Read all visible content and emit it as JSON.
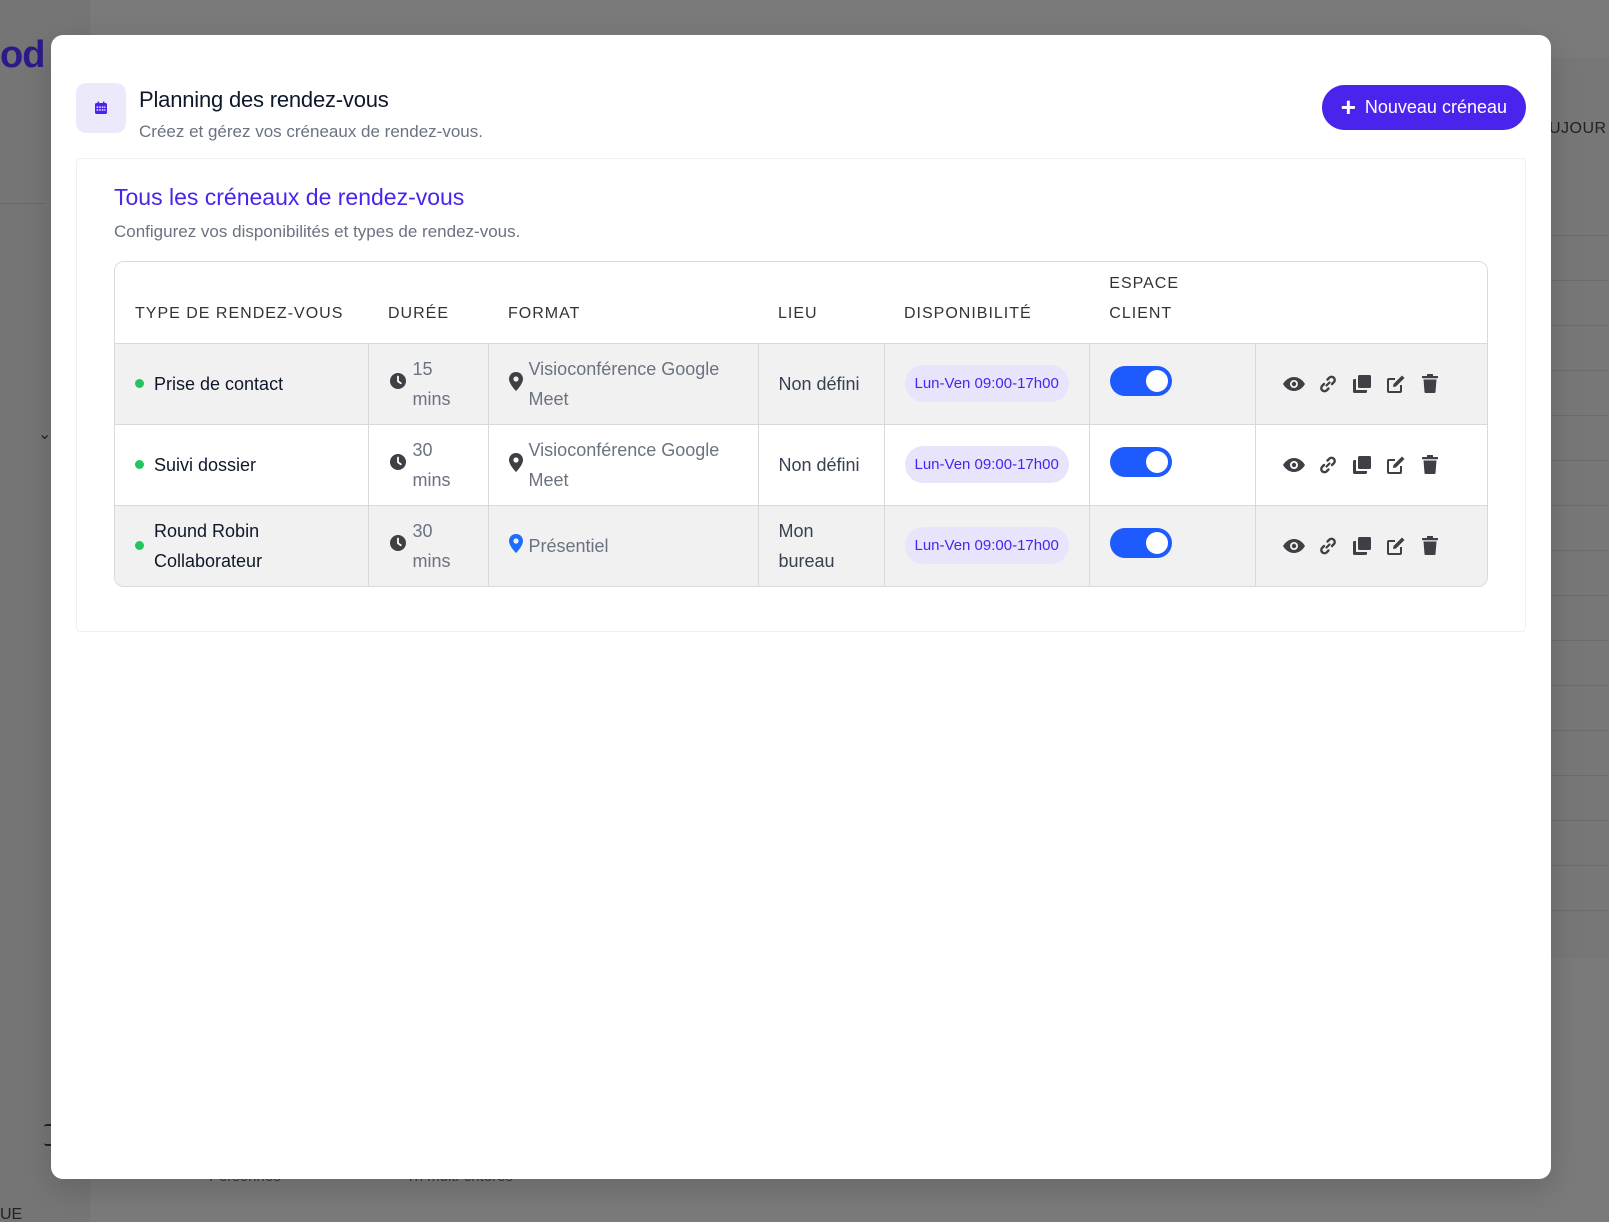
{
  "background": {
    "logo_text": "od",
    "today_label": "UJOUR",
    "bottom_left_text": "UE",
    "tabs": [
      "Personnes",
      "Tri multi-critères"
    ]
  },
  "header": {
    "title": "Planning des rendez-vous",
    "subtitle": "Créez et gérez vos créneaux de rendez-vous.",
    "icon": "calendar-icon",
    "new_button_label": "Nouveau créneau"
  },
  "card": {
    "title": "Tous les créneaux de rendez-vous",
    "subtitle": "Configurez vos disponibilités et types de rendez-vous."
  },
  "table": {
    "columns": {
      "type": "TYPE DE RENDEZ-VOUS",
      "duree": "DURÉE",
      "format": "FORMAT",
      "lieu": "LIEU",
      "disponibilite": "DISPONIBILITÉ",
      "espace_client": "ESPACE CLIENT"
    },
    "rows": [
      {
        "type": "Prise de contact",
        "duree": "15 mins",
        "format": "Visioconférence Google Meet",
        "lieu": "Non défini",
        "disponibilite": "Lun-Ven 09:00-17h00",
        "espace_client": true
      },
      {
        "type": "Suivi dossier",
        "duree": "30 mins",
        "format": "Visioconférence Google Meet",
        "lieu": "Non défini",
        "disponibilite": "Lun-Ven 09:00-17h00",
        "espace_client": true
      },
      {
        "type": "Round Robin Collaborateur",
        "duree": "30 mins",
        "format": "Présentiel",
        "lieu": "Mon bureau",
        "disponibilite": "Lun-Ven 09:00-17h00",
        "espace_client": true
      }
    ],
    "row_actions": [
      "eye-icon",
      "link-icon",
      "copy-icon",
      "edit-icon",
      "trash-icon"
    ]
  },
  "colors": {
    "accent": "#4a24ed",
    "toggle_on": "#1e5bff",
    "status_dot": "#22c55e",
    "pill_bg": "#e8e4fc",
    "presentiel_pin": "#1e6bff"
  }
}
